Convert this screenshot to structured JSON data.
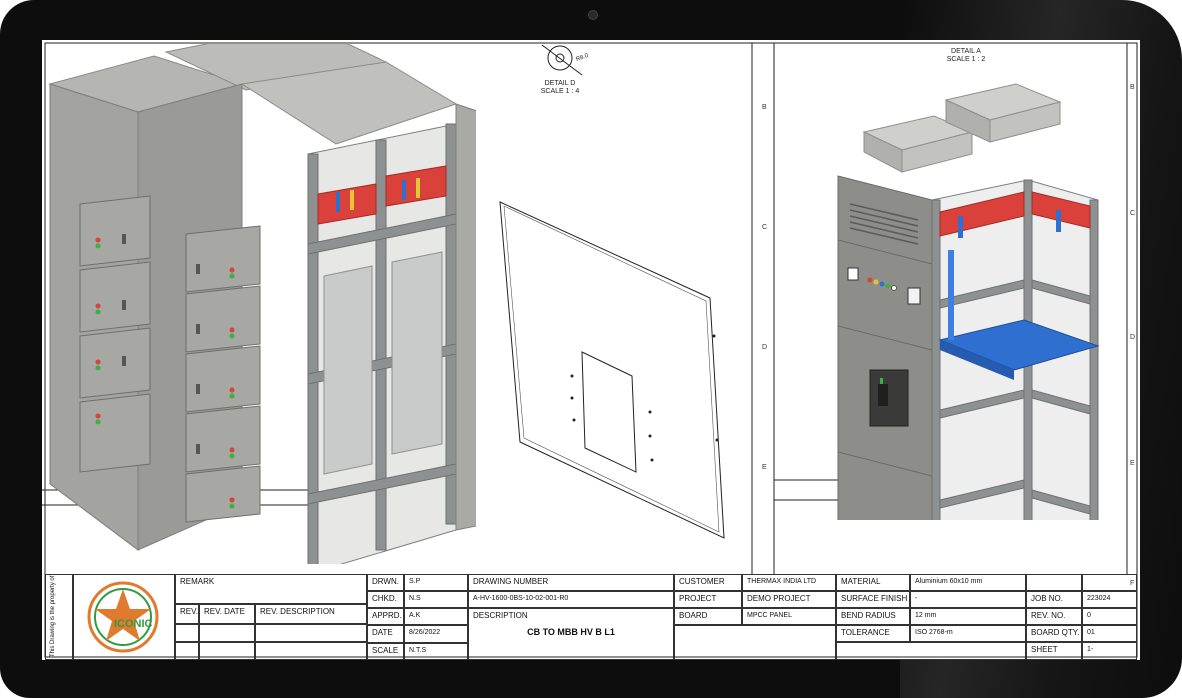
{
  "detail_d": {
    "title": "DETAIL D",
    "scale": "SCALE 1 : 4",
    "dim": "R8.0"
  },
  "detail_a": {
    "title": "DETAIL A",
    "scale": "SCALE 1 : 2"
  },
  "zone_letters": [
    "B",
    "C",
    "D",
    "E",
    "F"
  ],
  "logo_text": "ICONIC",
  "side_note": "This Drawing is the property of Iconic Engineers & Co.",
  "title_block": {
    "remark": "REMARK",
    "rev": "REV.",
    "rev_date": "REV. DATE",
    "rev_desc": "REV. DESCRIPTION",
    "drwn_label": "DRWN.",
    "drwn_value": "S.P",
    "chkd_label": "CHKD.",
    "chkd_value": "N.S",
    "apprd_label": "APPRD.",
    "apprd_value": "A.K",
    "date_label": "DATE",
    "date_value": "8/26/2022",
    "scale_label": "SCALE",
    "scale_value": "N.T.S",
    "drawing_number_label": "DRAWING NUMBER",
    "drawing_number_value": "A-HV-1600-0BS-10-02-001-R0",
    "description_label": "DESCRIPTION",
    "description_value": "CB TO MBB HV B L1",
    "customer_label": "CUSTOMER",
    "customer_value": "THERMAX INDIA LTD",
    "project_label": "PROJECT",
    "project_value": "DEMO PROJECT",
    "board_label": "BOARD",
    "board_value": "MPCC PANEL",
    "material_label": "MATERIAL",
    "material_value": "Aluminium 60x10 mm",
    "surface_label": "SURFACE FINISH",
    "surface_value": "-",
    "bend_label": "BEND RADIUS",
    "bend_value": "12 mm",
    "tolerance_label": "TOLERANCE",
    "tolerance_value": "ISO 2768-m",
    "job_label": "JOB NO.",
    "job_value": "223024",
    "revno_label": "REV. NO.",
    "revno_value": "0",
    "boardqty_label": "BOARD QTY.",
    "boardqty_value": "01",
    "sheet_label": "SHEET",
    "sheet_value": "1-"
  },
  "colors": {
    "cabinet": "#9a9b97",
    "busbar_red": "#d9413a",
    "frame": "#7c7f80",
    "blue_tray": "#2f6fd0"
  }
}
